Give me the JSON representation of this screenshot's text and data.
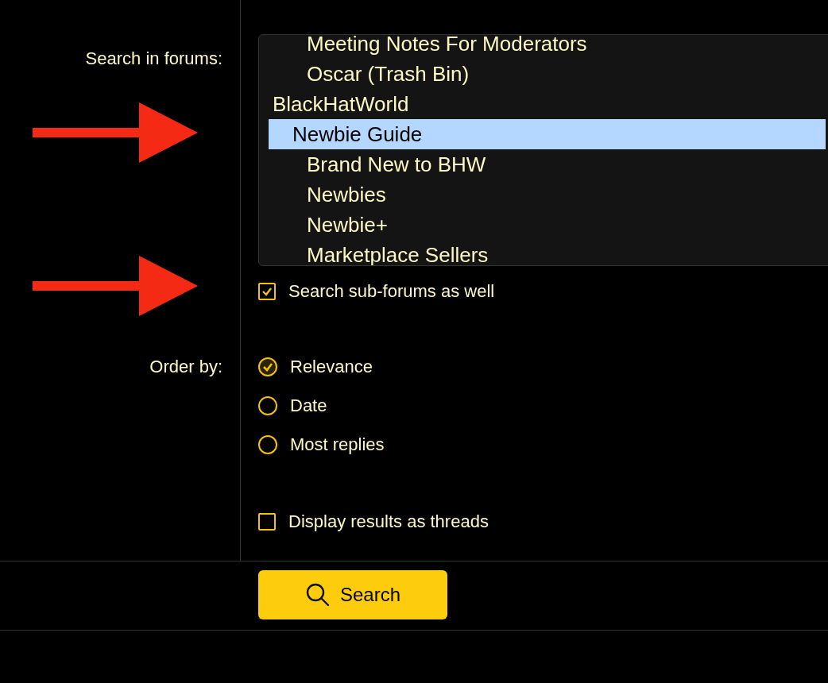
{
  "search_forums": {
    "label": "Search in forums:",
    "items": [
      {
        "children": [
          {
            "children": [
              {
                "label": "Meeting Notes For Moderators",
                "selected": false
              },
              {
                "label": "Oscar (Trash Bin)",
                "selected": false
              }
            ]
          }
        ]
      },
      {
        "label": "BlackHatWorld",
        "selected": false,
        "children": [
          {
            "label": "Newbie Guide",
            "selected": true,
            "children": [
              {
                "label": "Brand New to BHW",
                "selected": false
              },
              {
                "label": "Newbies",
                "selected": false
              },
              {
                "label": "Newbie+",
                "selected": false
              },
              {
                "label": "Marketplace Sellers",
                "selected": false
              }
            ]
          }
        ]
      }
    ]
  },
  "search_subforums": {
    "label": "Search sub-forums as well",
    "checked": true
  },
  "order_by": {
    "label": "Order by:",
    "options": [
      {
        "label": "Relevance",
        "selected": true
      },
      {
        "label": "Date",
        "selected": false
      },
      {
        "label": "Most replies",
        "selected": false
      }
    ]
  },
  "display_as_threads": {
    "label": "Display results as threads",
    "checked": false
  },
  "search_button": {
    "label": "Search"
  },
  "annotations": [
    {
      "kind": "arrow"
    },
    {
      "kind": "arrow"
    }
  ]
}
